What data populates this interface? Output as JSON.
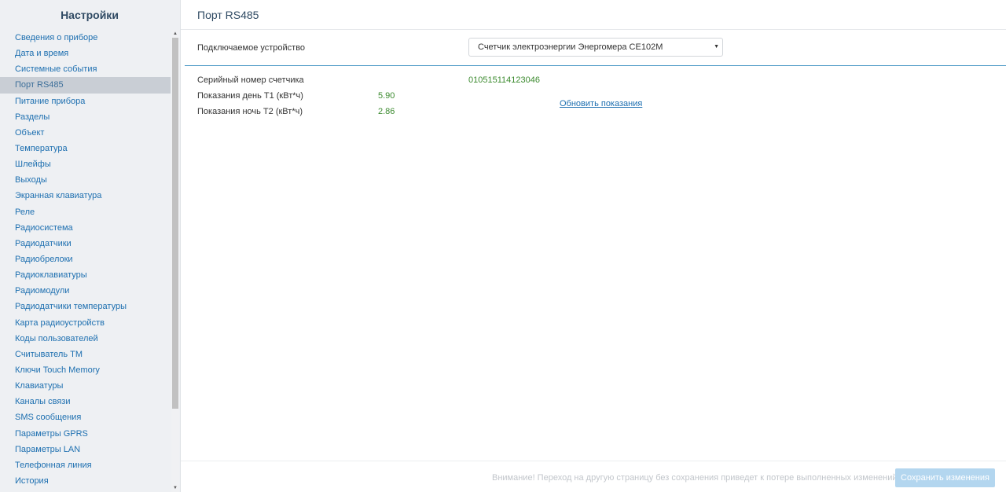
{
  "sidebar": {
    "title": "Настройки",
    "items": [
      {
        "label": "Сведения о приборе"
      },
      {
        "label": "Дата и время"
      },
      {
        "label": "Системные события"
      },
      {
        "label": "Порт RS485",
        "active": true
      },
      {
        "label": "Питание прибора"
      },
      {
        "label": "Разделы"
      },
      {
        "label": "Объект"
      },
      {
        "label": "Температура"
      },
      {
        "label": "Шлейфы"
      },
      {
        "label": "Выходы"
      },
      {
        "label": "Экранная клавиатура"
      },
      {
        "label": "Реле"
      },
      {
        "label": "Радиосистема"
      },
      {
        "label": "Радиодатчики"
      },
      {
        "label": "Радиобрелоки"
      },
      {
        "label": "Радиоклавиатуры"
      },
      {
        "label": "Радиомодули"
      },
      {
        "label": "Радиодатчики температуры"
      },
      {
        "label": "Карта радиоустройств"
      },
      {
        "label": "Коды пользователей"
      },
      {
        "label": "Считыватель TM"
      },
      {
        "label": "Ключи Touch Memory"
      },
      {
        "label": "Клавиатуры"
      },
      {
        "label": "Каналы связи"
      },
      {
        "label": "SMS сообщения"
      },
      {
        "label": "Параметры GPRS"
      },
      {
        "label": "Параметры LAN"
      },
      {
        "label": "Телефонная линия"
      },
      {
        "label": "История"
      }
    ]
  },
  "main": {
    "page_title": "Порт RS485",
    "device_label": "Подключаемое устройство",
    "device_select_value": "Счетчик электроэнергии Энергомера CE102M",
    "serial_label": "Серийный номер счетчика",
    "serial_value": "010515114123046",
    "day_label": "Показания день Т1 (кВт*ч)",
    "day_value": "5.90",
    "night_label": "Показания ночь Т2 (кВт*ч)",
    "night_value": "2.86",
    "refresh_link": "Обновить показания"
  },
  "footer": {
    "warning": "Внимание! Переход на другую страницу без сохранения приведет к потере выполненных изменений",
    "save_label": "Сохранить изменения"
  },
  "colors": {
    "accent": "#4f9bc7",
    "link": "#1d6fb0",
    "value_green": "#3b8a2e",
    "button_disabled": "#b3d6ef"
  }
}
